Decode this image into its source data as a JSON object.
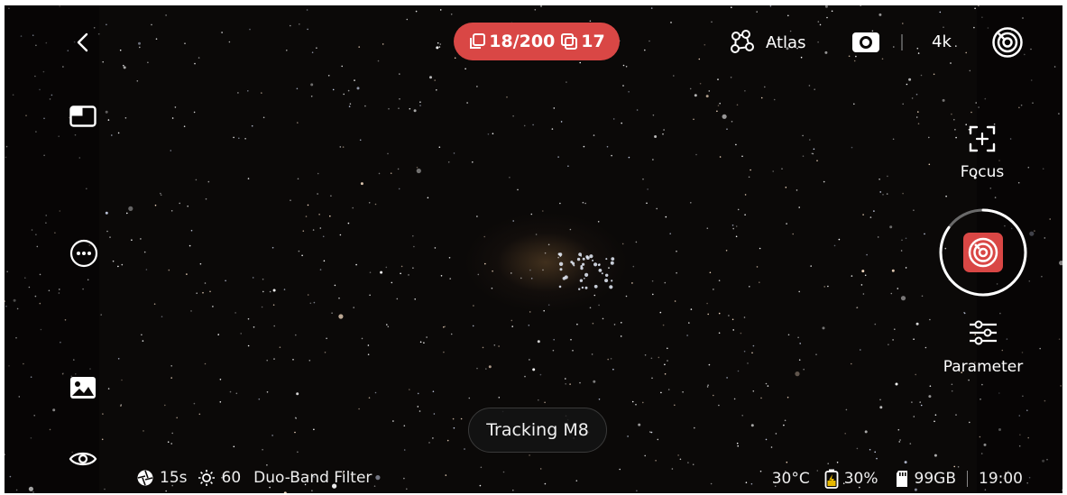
{
  "top_bar": {
    "frames_stacked": "18/200",
    "frames_skipped": "17",
    "atlas_label": "Atlas",
    "resolution": "4k"
  },
  "right_panel": {
    "focus_label": "Focus",
    "parameter_label": "Parameter",
    "shutter_progress": 0.85
  },
  "tracking": {
    "text": "Tracking M8"
  },
  "status_bar": {
    "exposure": "15s",
    "gain": "60",
    "filter": "Duo-Band Filter",
    "temperature": "30°C",
    "battery": "30%",
    "storage": "99GB",
    "time": "19:00"
  },
  "colors": {
    "accent_red": "#d94745",
    "background": "#0b0908"
  }
}
